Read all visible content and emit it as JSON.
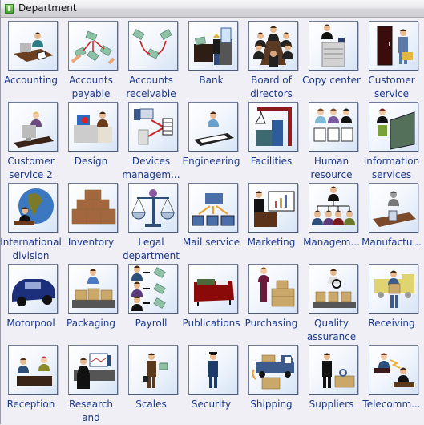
{
  "panel": {
    "title": "Department",
    "title_icon": "stencil-green-icon"
  },
  "colors": {
    "label_text": "#1c3a8c",
    "background": "#efeff5",
    "tile_border": "#6e7a96"
  },
  "items": [
    {
      "label": "Accounting",
      "icon": "accounting-icon"
    },
    {
      "label": "Accounts\npayable",
      "icon": "accounts-payable-icon"
    },
    {
      "label": "Accounts\nreceivable",
      "icon": "accounts-receivable-icon"
    },
    {
      "label": "Bank",
      "icon": "bank-icon"
    },
    {
      "label": "Board of\ndirectors",
      "icon": "board-of-directors-icon"
    },
    {
      "label": "Copy center",
      "icon": "copy-center-icon"
    },
    {
      "label": "Customer\nservice",
      "icon": "customer-service-icon"
    },
    {
      "label": "Customer\nservice 2",
      "icon": "customer-service-2-icon"
    },
    {
      "label": "Design",
      "icon": "design-icon"
    },
    {
      "label": "Devices\nmanagem...",
      "icon": "devices-management-icon"
    },
    {
      "label": "Engineering",
      "icon": "engineering-icon"
    },
    {
      "label": "Facilities",
      "icon": "facilities-icon"
    },
    {
      "label": "Human\nresource",
      "icon": "human-resource-icon"
    },
    {
      "label": "Information\nservices",
      "icon": "information-services-icon"
    },
    {
      "label": "International\ndivision",
      "icon": "international-division-icon"
    },
    {
      "label": "Inventory",
      "icon": "inventory-icon"
    },
    {
      "label": "Legal\ndepartment",
      "icon": "legal-department-icon"
    },
    {
      "label": "Mail service",
      "icon": "mail-service-icon"
    },
    {
      "label": "Marketing",
      "icon": "marketing-icon"
    },
    {
      "label": "Managem...",
      "icon": "management-icon"
    },
    {
      "label": "Manufactu...",
      "icon": "manufacturing-icon"
    },
    {
      "label": "Motorpool",
      "icon": "motorpool-icon"
    },
    {
      "label": "Packaging",
      "icon": "packaging-icon"
    },
    {
      "label": "Payroll",
      "icon": "payroll-icon"
    },
    {
      "label": "Publications",
      "icon": "publications-icon"
    },
    {
      "label": "Purchasing",
      "icon": "purchasing-icon"
    },
    {
      "label": "Quality\nassurance",
      "icon": "quality-assurance-icon"
    },
    {
      "label": "Receiving",
      "icon": "receiving-icon"
    },
    {
      "label": "Reception",
      "icon": "reception-icon"
    },
    {
      "label": "Research\nand",
      "icon": "research-and-development-icon"
    },
    {
      "label": "Scales",
      "icon": "scales-icon"
    },
    {
      "label": "Security",
      "icon": "security-icon"
    },
    {
      "label": "Shipping",
      "icon": "shipping-icon"
    },
    {
      "label": "Suppliers",
      "icon": "suppliers-icon"
    },
    {
      "label": "Telecomm...",
      "icon": "telecommunications-icon"
    }
  ]
}
